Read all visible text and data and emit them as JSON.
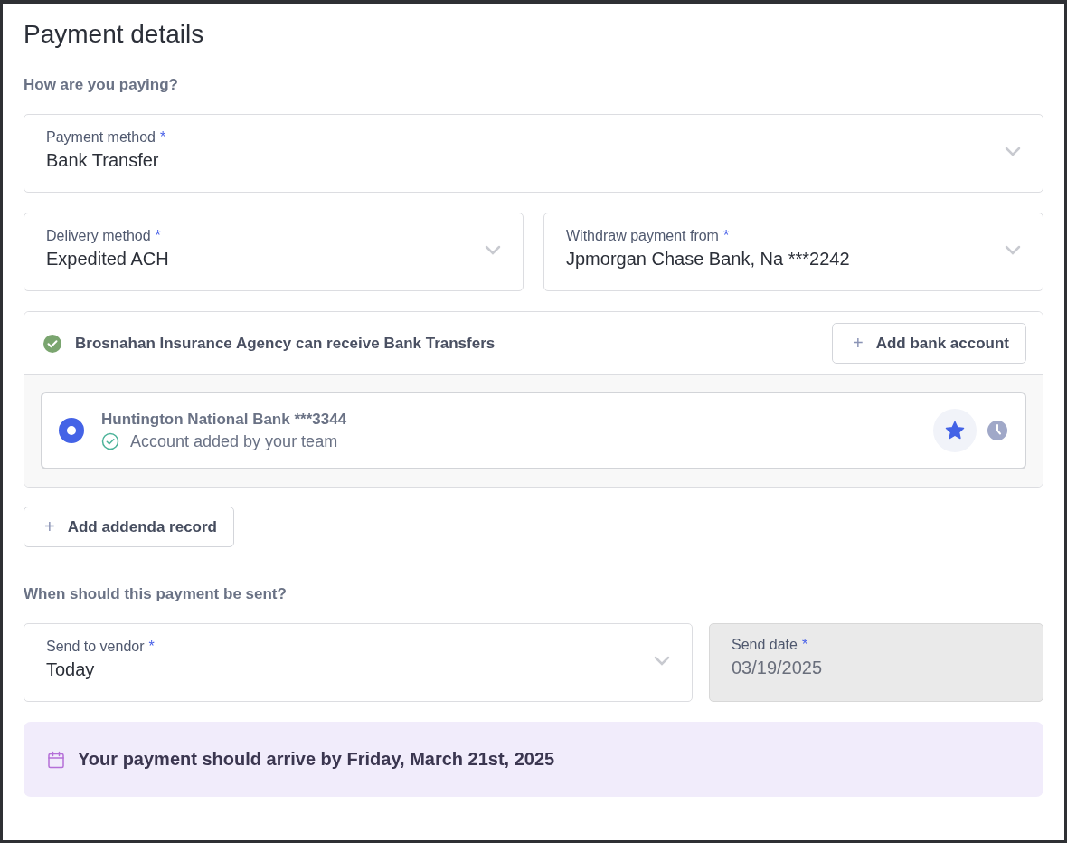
{
  "title": "Payment details",
  "section_1": "How are you paying?",
  "payment_method": {
    "label": "Payment method",
    "asterisk": "*",
    "value": "Bank Transfer",
    "kind": "select"
  },
  "row_fields": [
    {
      "label": "Delivery method",
      "asterisk": "*",
      "value": "Expedited ACH",
      "kind": "select"
    },
    {
      "label": "Withdraw payment from",
      "asterisk": "*",
      "value": "Jpmorgan Chase Bank, Na ***2242",
      "kind": "select"
    }
  ],
  "recipient": {
    "message": "Brosnahan Insurance Agency can receive Bank Transfers",
    "add_button": {
      "icon": "+",
      "label": "Add bank account"
    },
    "accounts": [
      {
        "name": "Huntington National Bank ***3344",
        "note": "Account added by your team",
        "selected": true,
        "favorite": true
      }
    ]
  },
  "addenda_button": {
    "icon": "+",
    "label": "Add addenda record"
  },
  "section_2": "When should this payment be sent?",
  "schedule_fields": [
    {
      "label": "Send to vendor",
      "asterisk": "*",
      "value": "Today",
      "kind": "select"
    },
    {
      "label": "Send date",
      "asterisk": "*",
      "value": "03/19/2025",
      "kind": "disabled"
    }
  ],
  "arrival_notice": "Your payment should arrive by Friday, March 21st, 2025"
}
